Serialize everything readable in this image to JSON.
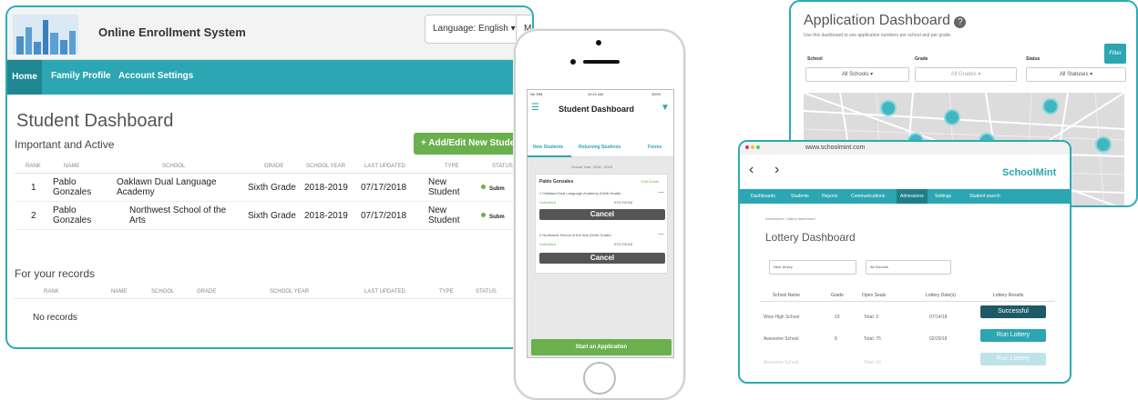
{
  "desktop": {
    "app_title": "Online Enrollment System",
    "language": "Language: English",
    "user": "Maria Gonzales",
    "nav": [
      "Home",
      "Family Profile",
      "Account Settings"
    ],
    "page_title": "Student Dashboard",
    "section1": "Important and Active",
    "add_button": "Add/Edit New Stude",
    "table1_headers": [
      "RANK",
      "NAME",
      "SCHOOL",
      "GRADE",
      "SCHOOL YEAR",
      "LAST UPDATED",
      "TYPE",
      "STATUS"
    ],
    "rows": [
      {
        "rank": "1",
        "name": "Pablo Gonzales",
        "school": "Oaklawn Dual Language Academy",
        "grade": "Sixth Grade",
        "year": "2018-2019",
        "updated": "07/17/2018",
        "type": "New Student",
        "status": "Subm"
      },
      {
        "rank": "2",
        "name": "Pablo Gonzales",
        "school": "Northwest School of the Arts",
        "grade": "Sixth Grade",
        "year": "2018-2019",
        "updated": "07/17/2018",
        "type": "New Student",
        "status": "Subm"
      }
    ],
    "section2": "For your records",
    "table2_headers": [
      "RANK",
      "NAME",
      "SCHOOL",
      "GRADE",
      "SCHOOL YEAR",
      "LAST UPDATED",
      "TYPE",
      "STATUS"
    ],
    "no_records": "No records",
    "colors": {
      "teal": "#2ba6b2",
      "green": "#6ab04c"
    }
  },
  "phone": {
    "status_left": "No SIM",
    "time": "10:21 AM",
    "battery": "100%",
    "title": "Student Dashboard",
    "tabs": [
      "New Students",
      "Returning Students",
      "Forms"
    ],
    "school_year": "School Year: 2018 - 2019",
    "student": "Pablo Gonzales",
    "edit": "Edit Grade",
    "apps": [
      {
        "school": "1  Oaklawn Dual Language Academy (Sixth Grade)",
        "status": "Submitted",
        "date": "07/17/2018",
        "cancel": "Cancel"
      },
      {
        "school": "2  Northwest School of the Arts (Sixth Grade)",
        "status": "Submitted",
        "date": "07/17/2018",
        "cancel": "Cancel"
      }
    ],
    "start": "Start an Application"
  },
  "appdash": {
    "title": "Application Dashboard",
    "desc": "Use this dashboard to see application numbers per school and per grade.",
    "labels": [
      "School",
      "Grade",
      "Status"
    ],
    "selects": [
      "All Schools",
      "All Grades",
      "All Statuses"
    ],
    "filter": "Filter"
  },
  "lottery": {
    "url": "www.schoolmint.com",
    "brand": "SchoolMint",
    "nav": [
      "Dashboards",
      "Students",
      "Reports",
      "Communications",
      "Admissions",
      "Settings",
      "Student search"
    ],
    "breadcrumb": "Admissions  /  lottery dashboard",
    "title": "Lottery Dashboard",
    "filter1": "New Jersey",
    "filter2": "All Schools",
    "headers": [
      "School Name",
      "Grade",
      "Open Seats",
      "Lottery Date(s)",
      "Lottery Results"
    ],
    "rows": [
      {
        "school": "Wow High School",
        "grade": "10",
        "seats": "Total: 2",
        "date": "07/14/18",
        "result": "Successful"
      },
      {
        "school": "Awesome School",
        "grade": "8",
        "seats": "Total: 75",
        "date": "02/20/18",
        "result": "Run Lottery"
      },
      {
        "school": "Awesome School",
        "grade": "",
        "seats": "Total: 54",
        "date": "",
        "result": "Run Lottery"
      }
    ]
  }
}
